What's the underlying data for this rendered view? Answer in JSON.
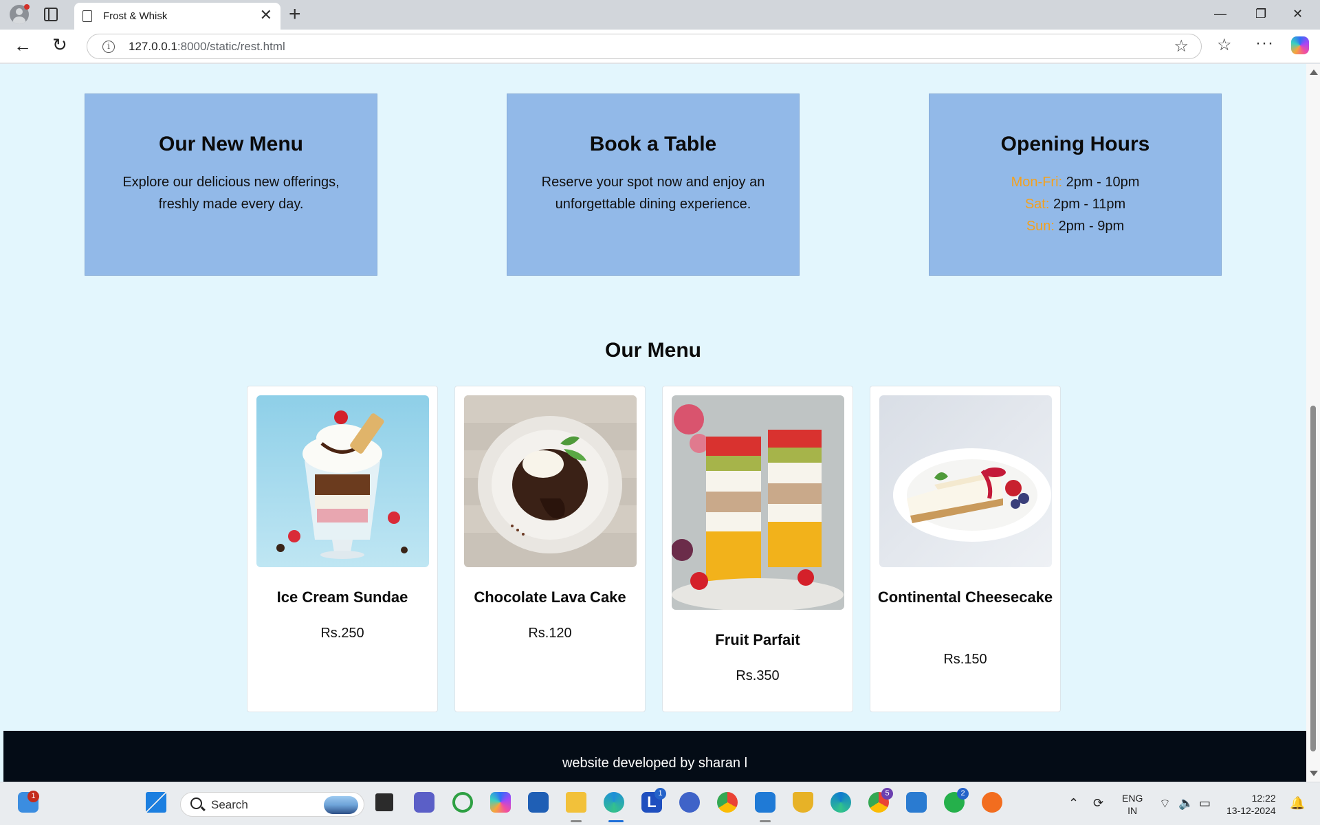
{
  "browser": {
    "tab_title": "Frost & Whisk",
    "url_host": "127.0.0.1",
    "url_rest": ":8000/static/rest.html"
  },
  "info_cards": [
    {
      "title": "Our New Menu",
      "text": "Explore our delicious new offerings, freshly made every day."
    },
    {
      "title": "Book a Table",
      "text": "Reserve your spot now and enjoy an unforgettable dining experience."
    },
    {
      "title": "Opening Hours",
      "hours": [
        {
          "day": "Mon-Fri:",
          "time": "2pm - 10pm"
        },
        {
          "day": "Sat:",
          "time": "2pm - 11pm"
        },
        {
          "day": "Sun:",
          "time": "2pm - 9pm"
        }
      ]
    }
  ],
  "menu": {
    "heading": "Our Menu",
    "items": [
      {
        "name": "Ice Cream Sundae",
        "price": "Rs.250",
        "image": "ice-cream-sundae-image"
      },
      {
        "name": "Chocolate Lava Cake",
        "price": "Rs.120",
        "image": "chocolate-lava-cake-image"
      },
      {
        "name": "Fruit Parfait",
        "price": "Rs.350",
        "image": "fruit-parfait-image"
      },
      {
        "name": "Continental Cheesecake",
        "price": "Rs.150",
        "image": "cheesecake-image"
      }
    ]
  },
  "footer": {
    "text": "website developed by sharan l"
  },
  "taskbar": {
    "search_label": "Search",
    "widgets_badge": "1",
    "lens_badge": "1",
    "chrome_badge": "5",
    "whatsapp_badge": "2",
    "lang_line1": "ENG",
    "lang_line2": "IN",
    "time": "12:22",
    "date": "13-12-2024"
  },
  "colors": {
    "page_background": "#e3f6fd",
    "info_card": "#92b9e8",
    "accent_day": "#f4a11d",
    "footer": "#040c16"
  }
}
